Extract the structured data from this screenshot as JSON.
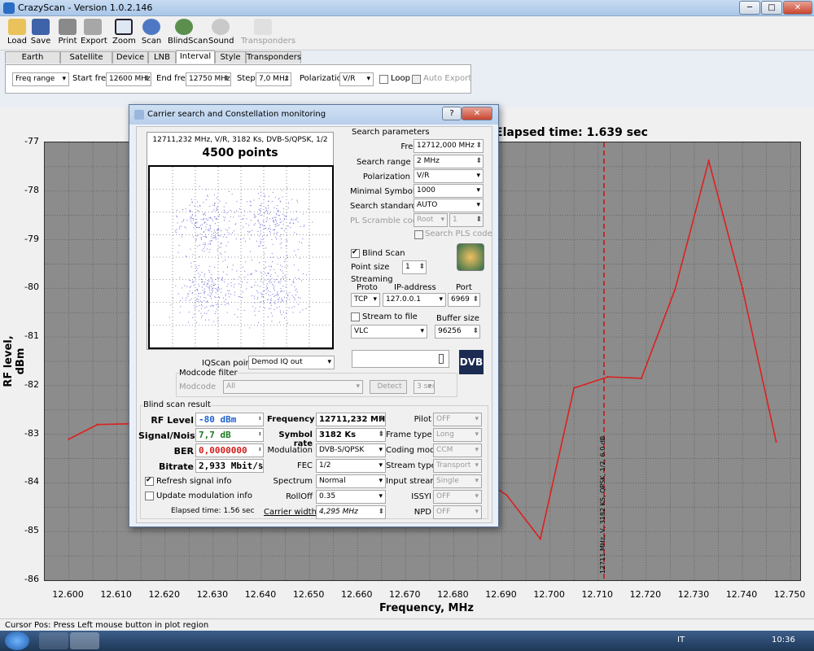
{
  "window": {
    "title": "CrazyScan - Version 1.0.2.146",
    "min": "─",
    "max": "□",
    "close": "✕"
  },
  "toolbar": [
    "Load",
    "Save",
    "Print",
    "Export",
    "Zoom",
    "Scan",
    "BlindScan",
    "Sound",
    "Transponders"
  ],
  "tabs": [
    "Earth position",
    "Satellite info",
    "Device",
    "LNB",
    "Interval",
    "Style",
    "Transponders"
  ],
  "interval": {
    "mode": "Freq range",
    "start_label": "Start freq",
    "start": "12600 MHz",
    "end_label": "End freq",
    "end": "12750 MHz",
    "step_label": "Step",
    "step": "7,0 MHz",
    "pol_label": "Polarization",
    "pol": "V/R",
    "loop": "Loop",
    "autoexport": "Auto Export"
  },
  "plot": {
    "elapsed": "Elapsed time: 1.639 sec",
    "ylabel": "RF level, dBm",
    "xlabel": "Frequency, MHz",
    "marker_label": "12711 MHz, V, 3182 KS, QPSK, 1/2, 6.0 dB"
  },
  "chart_data": {
    "type": "line",
    "x": [
      12600,
      12606,
      12614,
      12670,
      12691,
      12698,
      12705,
      12712,
      12719,
      12726,
      12733,
      12740,
      12747
    ],
    "values": [
      -83.1,
      -82.8,
      -82.78,
      -82.9,
      -84.25,
      -85.15,
      -82.05,
      -81.82,
      -81.85,
      -80.02,
      -77.38,
      -80.0,
      -83.15
    ],
    "xlim": [
      12595,
      12752
    ],
    "ylim": [
      -86,
      -77
    ],
    "xticks": [
      "12.600",
      "12.610",
      "12.620",
      "12.630",
      "12.640",
      "12.650",
      "12.660",
      "12.670",
      "12.680",
      "12.690",
      "12.700",
      "12.710",
      "12.720",
      "12.730",
      "12.740",
      "12.750"
    ],
    "yticks": [
      "-77",
      "-78",
      "-79",
      "-80",
      "-81",
      "-82",
      "-83",
      "-84",
      "-85",
      "-86"
    ],
    "marker_x": 12711.232,
    "line_color": "#dd2020",
    "marker_color": "#cc0000"
  },
  "status": "Cursor Pos: Press Left mouse button in plot region",
  "taskbar": {
    "lang": "IT",
    "time": "10:36"
  },
  "dialog": {
    "title": "Carrier search and Constellation monitoring",
    "help": "?",
    "close": "✕",
    "cons_header": "12711,232 MHz, V/R, 3182 Ks, DVB-S/QPSK, 1/2",
    "cons_points": "4500 points",
    "params_title": "Search parameters",
    "frequency_label": "Frequency",
    "frequency": "12712,000 MHz",
    "range_label": "Search range",
    "range": "2 MHz",
    "pol_label": "Polarization",
    "pol": "V/R",
    "minsr_label": "Minimal Symbol rate",
    "minsr": "1000",
    "standard_label": "Search standard",
    "standard": "AUTO",
    "pls_label": "PL Scramble code",
    "pls_mode": "Root",
    "pls_val": "1",
    "search_pls": "Search PLS code",
    "blindscan": "Blind Scan",
    "pointsize_label": "Point size",
    "pointsize": "1",
    "streaming": "Streaming",
    "proto_label": "Proto",
    "ip_label": "IP-address",
    "port_label": "Port",
    "proto": "TCP",
    "ip": "127.0.0.1",
    "port": "6969",
    "stream_file": "Stream to file",
    "buffer_label": "Buffer size",
    "player": "VLC",
    "buffer": "96256",
    "iqscan_label": "IQScan point",
    "iqscan": "Demod IQ out",
    "modcode_filter": "Modcode filter",
    "modcode_label": "Modcode",
    "modcode": "All",
    "detect": "Detect",
    "detect_time": "3 sec",
    "dvb_logo": "DVB",
    "result_title": "Blind scan result",
    "rf_label": "RF Level",
    "rf": "-80 dBm",
    "sn_label": "Signal/Noise",
    "sn": "7,7 dB",
    "ber_label": "BER",
    "ber": "0,0000000",
    "bitrate_label": "Bitrate",
    "bitrate": "2,933 Mbit/s",
    "refresh": "Refresh signal info",
    "update_mod": "Update modulation info",
    "elapsed": "Elapsed time: 1.56 sec",
    "freq_label": "Frequency",
    "freq": "12711,232 MHz",
    "sr_label": "Symbol rate",
    "sr": "3182 Ks",
    "mod_label": "Modulation",
    "mod": "DVB-S/QPSK",
    "fec_label": "FEC",
    "fec": "1/2",
    "spec_label": "Spectrum",
    "spec": "Normal",
    "rolloff_label": "RollOff",
    "rolloff": "0.35",
    "cw_label": "Carrier width",
    "cw": "4,295 MHz",
    "pilot_label": "Pilot",
    "pilot": "OFF",
    "frame_label": "Frame type",
    "frame": "Long",
    "coding_label": "Coding mode",
    "coding": "CCM",
    "stype_label": "Stream type",
    "stype": "Transport",
    "istream_label": "Input stream",
    "istream": "Single",
    "issyi_label": "ISSYI",
    "issyi": "OFF",
    "npd_label": "NPD",
    "npd": "OFF"
  }
}
